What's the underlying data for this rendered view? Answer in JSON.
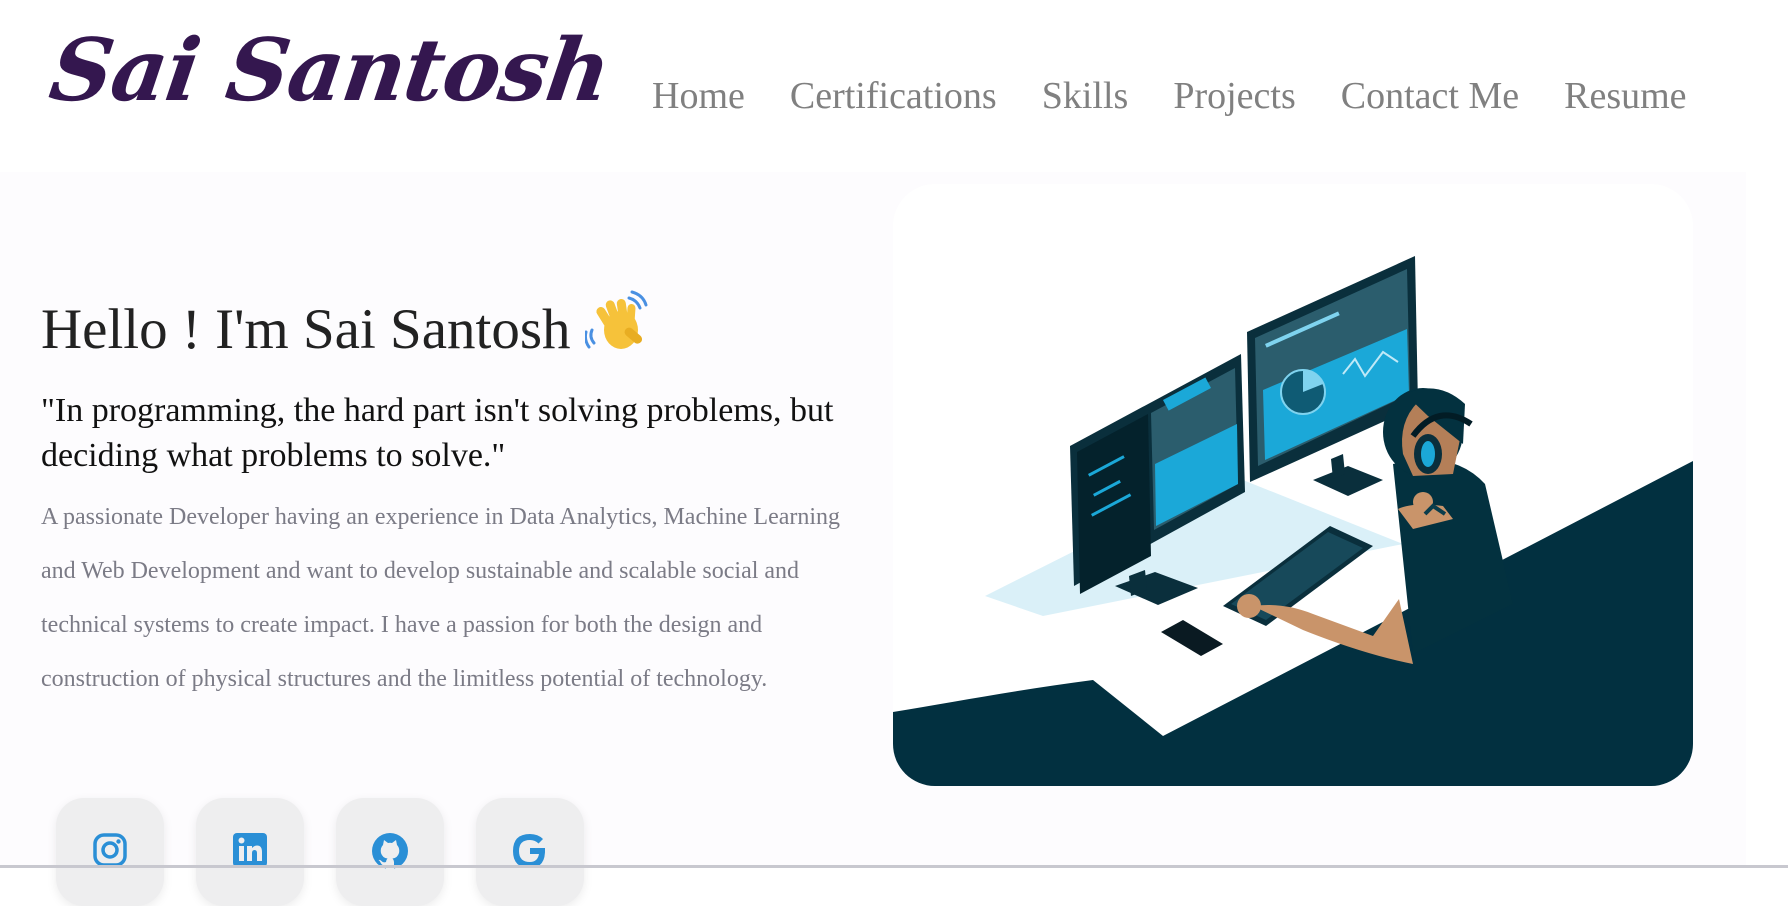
{
  "header": {
    "logo_text": "Sai Santosh",
    "nav": [
      "Home",
      "Certifications",
      "Skills",
      "Projects",
      "Contact Me",
      "Resume"
    ]
  },
  "hero": {
    "greeting": "Hello ! I'm Sai Santosh",
    "quote": "\"In programming, the hard part isn't solving problems, but deciding what problems to solve.\"",
    "about": "A passionate Developer having an experience in Data Analytics, Machine Learning and Web Development and want to develop sustainable and scalable social and technical systems to create impact. I have a passion for both the design and construction of physical structures and the limitless potential of technology."
  },
  "socials": [
    {
      "name": "instagram-icon"
    },
    {
      "name": "linkedin-icon"
    },
    {
      "name": "github-icon"
    },
    {
      "name": "google-icon"
    }
  ],
  "colors": {
    "logo": "#34174f",
    "nav_text": "#808080",
    "body_text": "#7b7b86",
    "icon_blue": "#2a8fd6",
    "illustration_dark": "#023040",
    "illustration_accent": "#1ba8d8"
  }
}
